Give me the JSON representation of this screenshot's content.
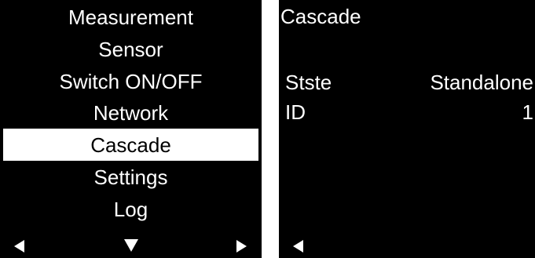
{
  "left_screen": {
    "menu_items": [
      {
        "label": "Measurement",
        "selected": false
      },
      {
        "label": "Sensor",
        "selected": false
      },
      {
        "label": "Switch ON/OFF",
        "selected": false
      },
      {
        "label": "Network",
        "selected": false
      },
      {
        "label": "Cascade",
        "selected": true
      },
      {
        "label": "Settings",
        "selected": false
      },
      {
        "label": "Log",
        "selected": false
      }
    ],
    "nav_icons": [
      "left-arrow-icon",
      "down-arrow-icon",
      "right-arrow-icon"
    ]
  },
  "right_screen": {
    "title": "Cascade",
    "rows": [
      {
        "label": "Stste",
        "value": "Standalone"
      },
      {
        "label": "ID",
        "value": "1"
      }
    ],
    "nav_icons": [
      "left-arrow-icon"
    ]
  },
  "colors": {
    "screen_background": "#000000",
    "text": "#ffffff",
    "selection_background": "#ffffff",
    "selection_text": "#000000"
  }
}
